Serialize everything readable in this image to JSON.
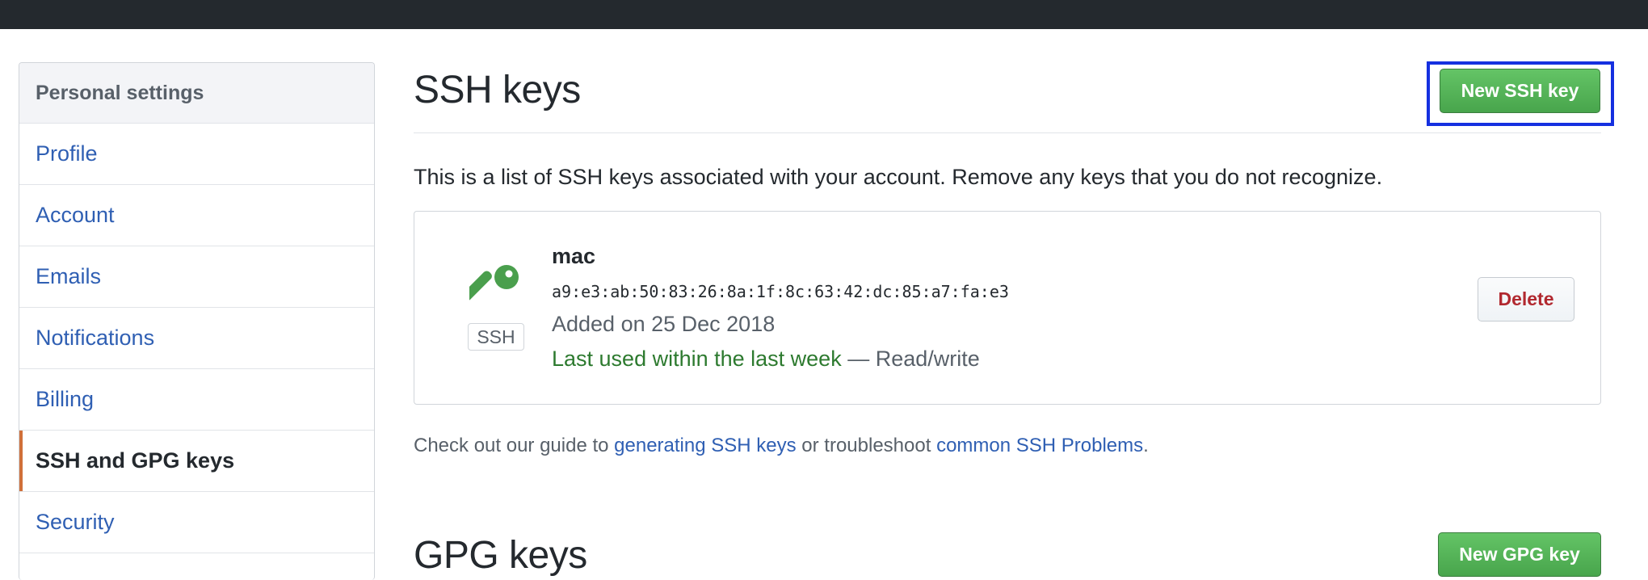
{
  "sidebar": {
    "header": "Personal settings",
    "items": [
      {
        "label": "Profile",
        "selected": false
      },
      {
        "label": "Account",
        "selected": false
      },
      {
        "label": "Emails",
        "selected": false
      },
      {
        "label": "Notifications",
        "selected": false
      },
      {
        "label": "Billing",
        "selected": false
      },
      {
        "label": "SSH and GPG keys",
        "selected": true
      },
      {
        "label": "Security",
        "selected": false
      }
    ]
  },
  "ssh": {
    "title": "SSH keys",
    "new_button": "New SSH key",
    "description": "This is a list of SSH keys associated with your account. Remove any keys that you do not recognize.",
    "keys": [
      {
        "icon": "key-icon",
        "badge": "SSH",
        "name": "mac",
        "fingerprint": "a9:e3:ab:50:83:26:8a:1f:8c:63:42:dc:85:a7:fa:e3",
        "added": "Added on 25 Dec 2018",
        "last_used": "Last used within the last week",
        "access": "— Read/write",
        "delete_label": "Delete"
      }
    ],
    "guide": {
      "prefix": "Check out our guide to ",
      "link1": "generating SSH keys",
      "middle": " or troubleshoot ",
      "link2": "common SSH Problems",
      "suffix": "."
    }
  },
  "gpg": {
    "title": "GPG keys",
    "new_button": "New GPG key"
  },
  "colors": {
    "topbar": "#24292e",
    "link": "#2f5fb3",
    "primary_button": "#4caf50",
    "danger": "#b1282f",
    "selected_indicator": "#d0703a",
    "highlight_box": "#1530e0",
    "last_used": "#2d7a2f"
  }
}
